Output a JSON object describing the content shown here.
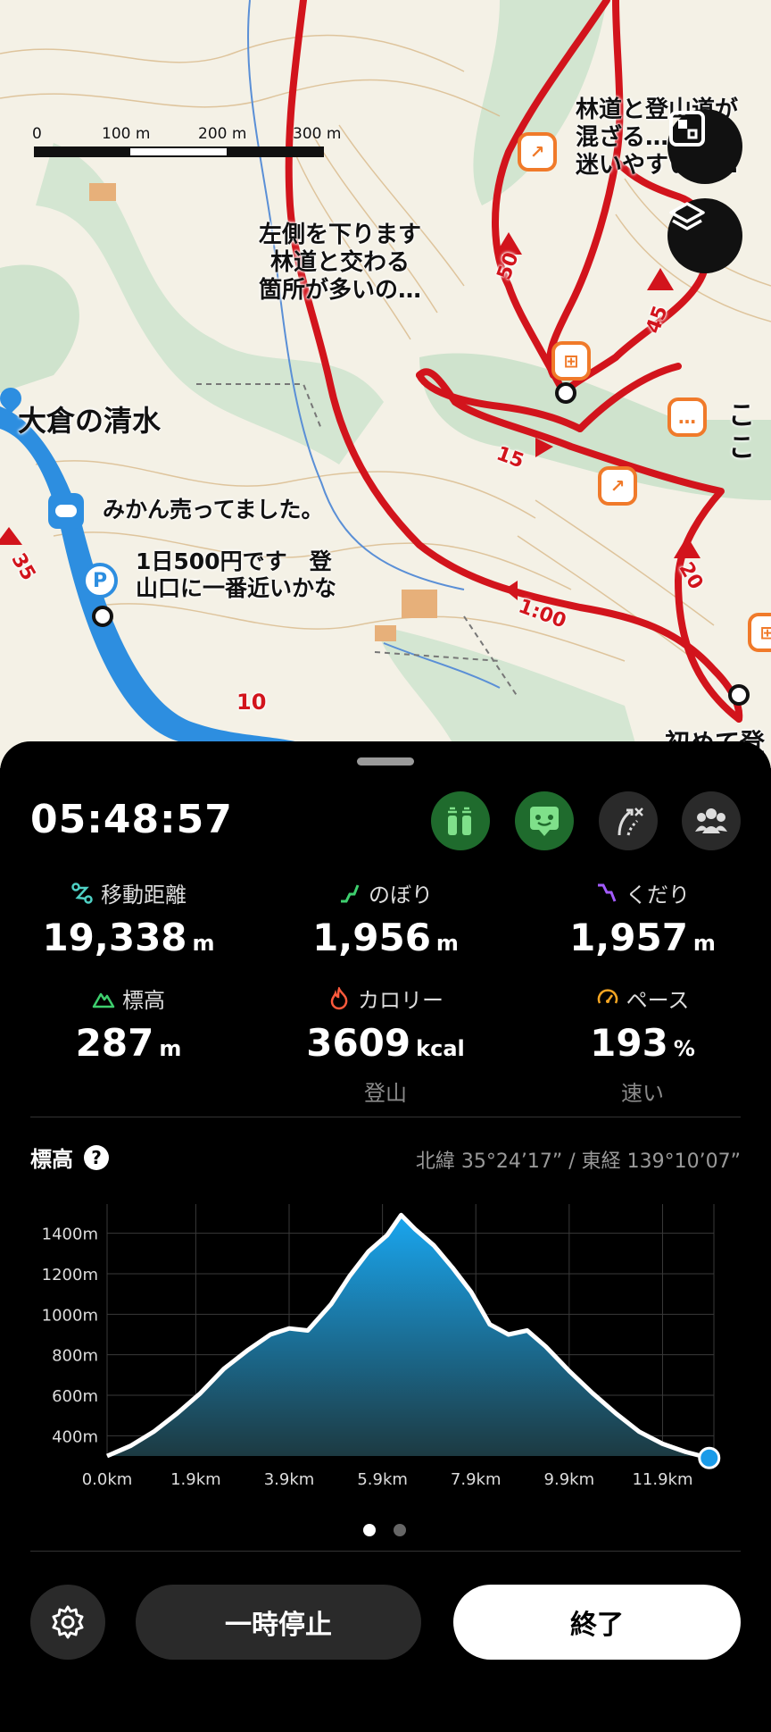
{
  "map": {
    "scale_labels": [
      "0",
      "100 m",
      "200 m",
      "300 m"
    ],
    "place_name": "大倉の清水",
    "notes": [
      "左側を下ります\n林道と交わる\n箇所が多いの…",
      "林道と登山道が\n混ざる…。\n迷いやすいの…",
      "みかん売ってました。",
      "1日500円です　登\n山口に一番近いかな",
      "ここ",
      "初めて登"
    ],
    "route_labels": [
      "50",
      "45",
      "15",
      "20",
      "35",
      "1:00",
      "10"
    ]
  },
  "tracking": {
    "timer": "05:48:57",
    "stats": [
      {
        "label": "移動距離",
        "value": "19,338",
        "unit": "m",
        "sub": "",
        "color": "#4fd1c5"
      },
      {
        "label": "のぼり",
        "value": "1,956",
        "unit": "m",
        "sub": "",
        "color": "#3ecf6e"
      },
      {
        "label": "くだり",
        "value": "1,957",
        "unit": "m",
        "sub": "",
        "color": "#a35bff"
      },
      {
        "label": "標高",
        "value": "287",
        "unit": "m",
        "sub": "",
        "color": "#3ecf6e"
      },
      {
        "label": "カロリー",
        "value": "3609",
        "unit": "kcal",
        "sub": "登山",
        "color": "#ff5a3c"
      },
      {
        "label": "ペース",
        "value": "193",
        "unit": "%",
        "sub": "速い",
        "color": "#f5a623"
      }
    ]
  },
  "elevation": {
    "title": "標高",
    "coords": "北緯 35°24’17” / 東経 139°10’07”"
  },
  "chart_data": {
    "type": "area",
    "title": "標高",
    "x_ticks": [
      "0.0km",
      "1.9km",
      "3.9km",
      "5.9km",
      "7.9km",
      "9.9km",
      "11.9km"
    ],
    "y_ticks": [
      "1400m",
      "1200m",
      "1000m",
      "800m",
      "600m",
      "400m"
    ],
    "xlim": [
      0,
      13.0
    ],
    "ylim": [
      300,
      1500
    ],
    "x": [
      0.0,
      0.5,
      1.0,
      1.5,
      2.0,
      2.5,
      3.0,
      3.5,
      3.9,
      4.3,
      4.8,
      5.2,
      5.6,
      6.0,
      6.3,
      6.6,
      7.0,
      7.4,
      7.8,
      8.2,
      8.6,
      9.0,
      9.4,
      9.9,
      10.4,
      10.9,
      11.4,
      11.9,
      12.4,
      12.9
    ],
    "y": [
      300,
      350,
      420,
      510,
      610,
      730,
      820,
      900,
      930,
      920,
      1050,
      1190,
      1310,
      1390,
      1490,
      1420,
      1340,
      1230,
      1110,
      950,
      900,
      920,
      840,
      720,
      610,
      510,
      420,
      360,
      320,
      290
    ],
    "accent": "#1a9be8"
  },
  "pager": {
    "count": 2,
    "active": 0
  },
  "controls": {
    "pause_label": "一時停止",
    "finish_label": "終了"
  }
}
